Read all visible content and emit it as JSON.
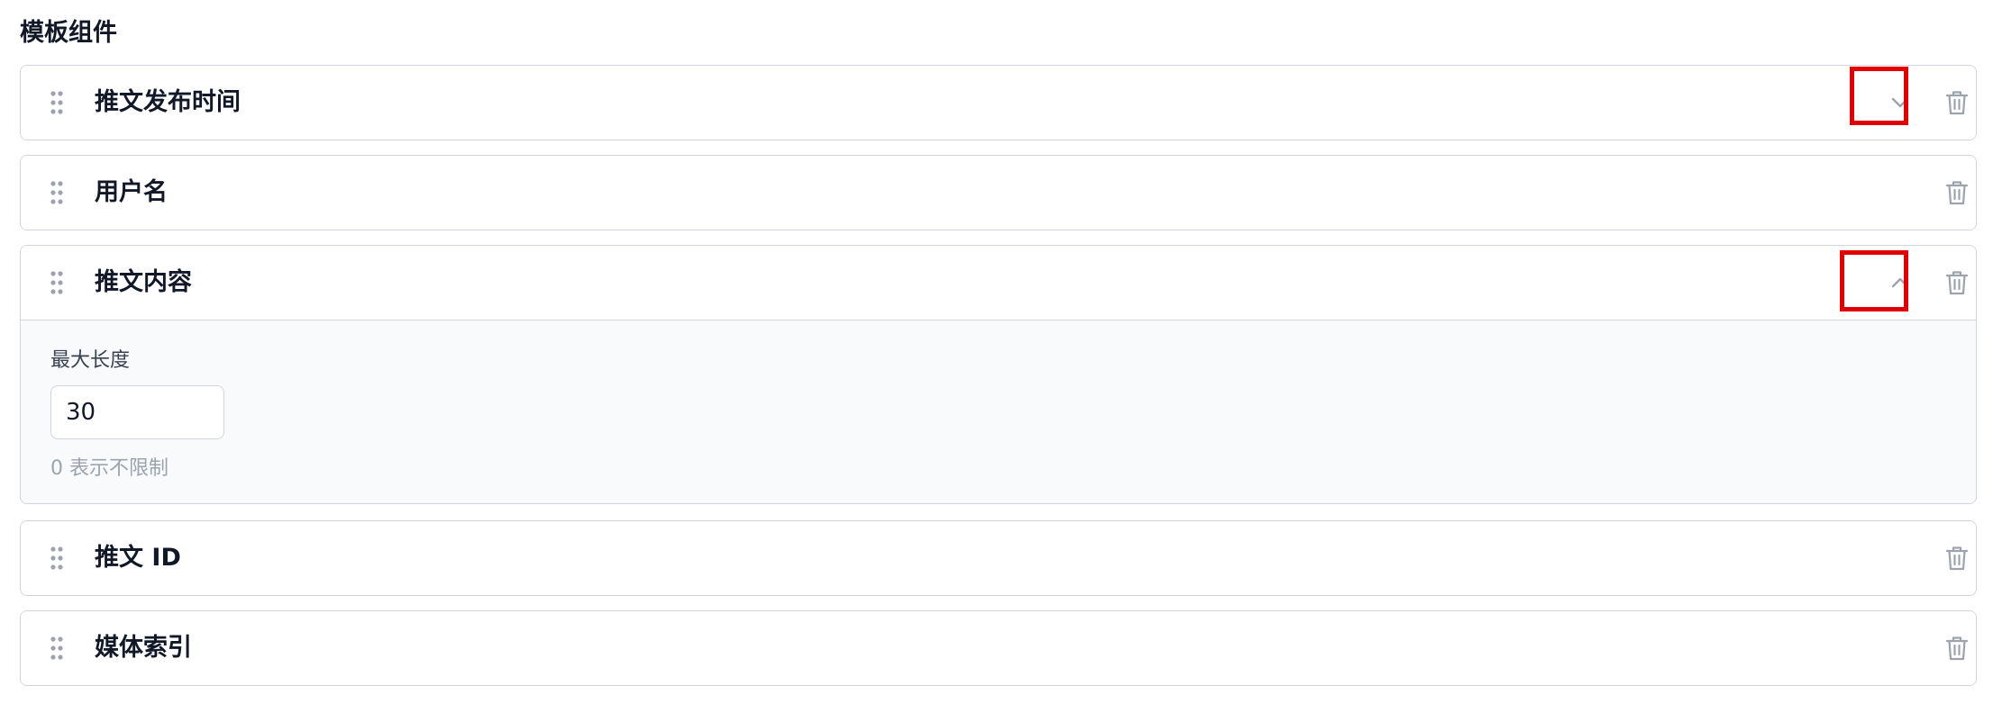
{
  "section": {
    "title": "模板组件"
  },
  "components": [
    {
      "title": "推文发布时间",
      "chevron": "chevron-down"
    },
    {
      "title": "用户名"
    },
    {
      "title": "推文内容",
      "chevron": "chevron-up",
      "field": {
        "label": "最大长度",
        "value": "30",
        "hint": "0 表示不限制"
      }
    },
    {
      "title": "推文 ID"
    },
    {
      "title": "媒体索引"
    }
  ],
  "colors": {
    "highlight": "#e00000",
    "border": "#d1d5db",
    "icon": "#9ca3af",
    "body_bg": "#f8fafc"
  }
}
